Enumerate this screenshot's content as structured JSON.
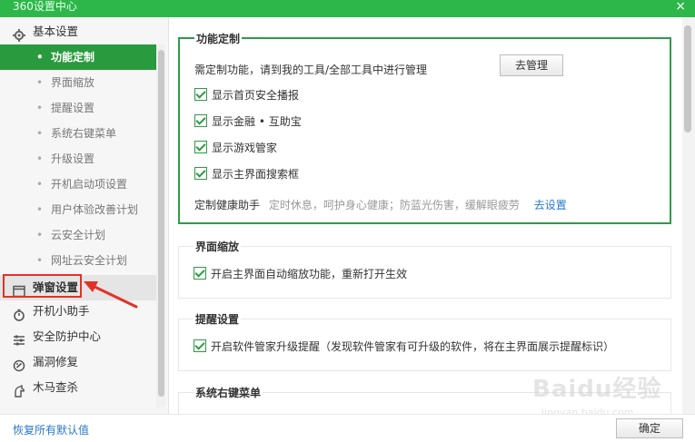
{
  "window": {
    "title": "360设置中心",
    "close_symbol": "×"
  },
  "sidebar": {
    "items": [
      {
        "label": "基本设置",
        "icon": "gear-icon",
        "type": "section"
      },
      {
        "label": "功能定制",
        "type": "sub",
        "active": true
      },
      {
        "label": "界面缩放",
        "type": "sub"
      },
      {
        "label": "提醒设置",
        "type": "sub"
      },
      {
        "label": "系统右键菜单",
        "type": "sub"
      },
      {
        "label": "升级设置",
        "type": "sub"
      },
      {
        "label": "开机启动项设置",
        "type": "sub"
      },
      {
        "label": "用户体验改善计划",
        "type": "sub"
      },
      {
        "label": "云安全计划",
        "type": "sub"
      },
      {
        "label": "网址云安全计划",
        "type": "sub"
      },
      {
        "label": "弹窗设置",
        "icon": "window-icon",
        "type": "section",
        "highlighted": true
      },
      {
        "label": "开机小助手",
        "icon": "stopwatch-icon",
        "type": "section"
      },
      {
        "label": "安全防护中心",
        "icon": "sliders-icon",
        "type": "section"
      },
      {
        "label": "漏洞修复",
        "icon": "patch-icon",
        "type": "section"
      },
      {
        "label": "木马查杀",
        "icon": "horse-icon",
        "type": "section"
      }
    ],
    "bullet": "•"
  },
  "main": {
    "feature_custom": {
      "title": "功能定制",
      "intro": "需定制功能，请到我的工具/全部工具中进行管理",
      "manage_button": "去管理",
      "options": [
        {
          "label": "显示首页安全播报",
          "checked": true
        },
        {
          "label": "显示金融 • 互助宝",
          "checked": true
        },
        {
          "label": "显示游戏管家",
          "checked": true
        },
        {
          "label": "显示主界面搜索框",
          "checked": true
        }
      ],
      "health_label": "定制健康助手",
      "health_hint": "定时休息，呵护身心健康；防蓝光伤害，缓解眼疲劳",
      "health_link": "去设置"
    },
    "zoom": {
      "title": "界面缩放",
      "option": {
        "label": "开启主界面自动缩放功能，重新打开生效",
        "checked": true
      }
    },
    "reminder": {
      "title": "提醒设置",
      "option": {
        "label": "开启软件管家升级提醒（发现软件管家有可升级的软件，将在主界面展示提醒标识）",
        "checked": true
      }
    },
    "context_menu": {
      "title": "系统右键菜单"
    }
  },
  "footer": {
    "reset_link": "恢复所有默认值",
    "ok_button": "确定"
  },
  "watermark": {
    "main": "Baidu经验",
    "sub": "jingyan.baidu.com"
  },
  "colors": {
    "brand_green": "#2db74a",
    "active_green": "#2a9a3e",
    "annotation_red": "#e23228",
    "link_blue": "#2a79c7"
  }
}
